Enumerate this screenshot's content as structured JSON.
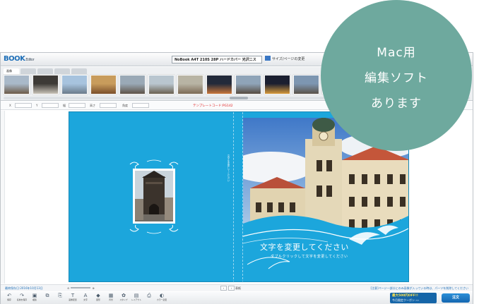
{
  "app": {
    "logo": "BOOK",
    "logo_sub": "Editor",
    "product": "NoBook A4T 210S 28P ハードカバー 光沢ニス",
    "size_link": "サイズ/ページの変更"
  },
  "thumb_tabs": [
    "画像",
    "",
    "",
    "",
    ""
  ],
  "thumbnails": [
    {
      "name": "thumb-1",
      "colors": [
        "#a9b9c9",
        "#6c5a48"
      ]
    },
    {
      "name": "thumb-2",
      "colors": [
        "#3d3a36",
        "#c9c3b8"
      ]
    },
    {
      "name": "thumb-3",
      "colors": [
        "#a7c3de",
        "#6b7b8a"
      ]
    },
    {
      "name": "thumb-4",
      "colors": [
        "#c89c5c",
        "#7a4e2a"
      ]
    },
    {
      "name": "thumb-5",
      "colors": [
        "#9aa9b6",
        "#5e5247"
      ]
    },
    {
      "name": "thumb-6",
      "colors": [
        "#b9c6cf",
        "#6a6050"
      ]
    },
    {
      "name": "thumb-7",
      "colors": [
        "#b8b4a4",
        "#7c6a55"
      ]
    },
    {
      "name": "thumb-8",
      "colors": [
        "#222a3a",
        "#c9763a"
      ]
    },
    {
      "name": "thumb-9",
      "colors": [
        "#8fa4b8",
        "#564b40"
      ]
    },
    {
      "name": "thumb-10",
      "colors": [
        "#1b1f30",
        "#d79a3c"
      ]
    },
    {
      "name": "thumb-11",
      "colors": [
        "#7d96b1",
        "#5a5248"
      ]
    },
    {
      "name": "thumb-12",
      "colors": [
        "#2d2a28",
        "#b2a48f"
      ]
    }
  ],
  "properties": {
    "x": "X",
    "y": "Y",
    "w": "幅",
    "h": "高さ",
    "angle": "角度",
    "template_code": "テンプレートコード:PG142"
  },
  "cover": {
    "title": "文字を変更してください",
    "subtitle": "ダブルクリックして文字を変更してください",
    "spine": "文字を変更してください"
  },
  "status": {
    "left": "最終保存日:2016年10月13日",
    "zoom_label": "",
    "page_label": "表紙",
    "right": "[注意]ページ一部分にのみ画像が入っている時は、パーツを削除してください"
  },
  "toolbar": [
    {
      "label": "保存",
      "icon": "undo-icon",
      "glyph": "↶"
    },
    {
      "label": "名前を保存",
      "icon": "redo-icon",
      "glyph": "↷"
    },
    {
      "label": "複製",
      "icon": "image-icon",
      "glyph": "▣"
    },
    {
      "label": "",
      "icon": "copy-icon",
      "glyph": "⧉"
    },
    {
      "label": "",
      "icon": "paste-icon",
      "glyph": "⎘"
    },
    {
      "label": "画像配置",
      "icon": "text-icon",
      "glyph": "T"
    },
    {
      "label": "文字",
      "icon": "textbox-icon",
      "glyph": "A"
    },
    {
      "label": "図形",
      "icon": "shape-icon",
      "glyph": "◆"
    },
    {
      "label": "背景",
      "icon": "background-icon",
      "glyph": "▦"
    },
    {
      "label": "スタンプ",
      "icon": "stamp-icon",
      "glyph": "✿"
    },
    {
      "label": "レイアウト",
      "icon": "layout-icon",
      "glyph": "▤"
    },
    {
      "label": "",
      "icon": "print-icon",
      "glyph": "⎙"
    },
    {
      "label": "カラー変更",
      "icon": "color-icon",
      "glyph": "◐"
    }
  ],
  "coupon": {
    "line1": "最大500円OFF!!",
    "line2": "今月限定クーポン ›››"
  },
  "order_button": "注文",
  "badge": {
    "lines": [
      "Mac用",
      "編集ソフト",
      "あります"
    ]
  },
  "colors": {
    "cover_blue": "#1ca6dc",
    "badge_green": "#6ea99e",
    "accent": "#1e6fb8",
    "template_code_red": "#e02424"
  }
}
